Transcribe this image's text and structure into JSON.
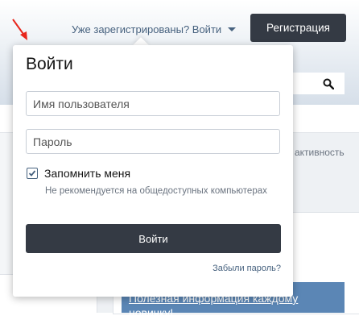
{
  "header": {
    "login_link": "Уже зарегистрированы? Войти",
    "register_label": "Регистрация"
  },
  "page": {
    "activity_text": "активность",
    "info_text": "Полезная информация каждому новичку!"
  },
  "login_popup": {
    "title": "Войти",
    "username_placeholder": "Имя пользователя",
    "password_placeholder": "Пароль",
    "remember_label": "Запомнить меня",
    "remember_checked": true,
    "remember_hint": "Не рекомендуется на общедоступных компьютерах",
    "submit_label": "Войти",
    "forgot_label": "Забыли пароль?"
  },
  "icons": {
    "search": "search-icon",
    "caret": "caret-down-icon",
    "check": "checkmark-icon",
    "annotation": "red-arrow-icon"
  },
  "colors": {
    "button_dark": "#343a44",
    "link": "#47627f",
    "info_block": "#5b86b5",
    "annotation": "#e8261c"
  }
}
